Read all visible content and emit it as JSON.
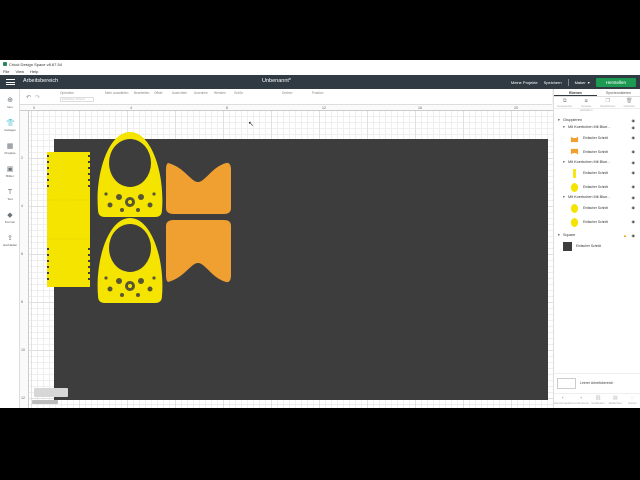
{
  "app": {
    "window_title": "Cricut Design Space  v8.67.54",
    "menu": [
      "File",
      "View",
      "Help"
    ]
  },
  "header": {
    "workspace": "Arbeitsbereich",
    "document_title": "Unbenannt*",
    "my_projects": "Meine Projekte",
    "save": "Speichern",
    "machine": "Maker",
    "make_button": "Herstellen",
    "accent_color": "#1d9a52",
    "bg_color": "#2f3a43"
  },
  "toolbar": {
    "undo_icon": "undo-icon",
    "redo_icon": "redo-icon",
    "select_all": "Alles auswählen",
    "tools": [
      {
        "label": "Operation",
        "value": "Einfacher Schnitt"
      },
      {
        "label": "Mehr auswählen",
        "value": ""
      },
      {
        "label": "Bearbeiten",
        "value": ""
      },
      {
        "label": "Offset",
        "value": ""
      },
      {
        "label": "Ausrichten",
        "value": ""
      },
      {
        "label": "Anordnen",
        "value": ""
      },
      {
        "label": "Wenden",
        "value": ""
      },
      {
        "label": "Größe",
        "value": ""
      },
      {
        "label": "Drehen",
        "value": ""
      },
      {
        "label": "Position",
        "value": ""
      }
    ]
  },
  "sidebar": {
    "items": [
      {
        "label": "Neu",
        "icon": "plus-icon"
      },
      {
        "label": "Vorlagen",
        "icon": "shirt-icon"
      },
      {
        "label": "Projekte",
        "icon": "projects-icon"
      },
      {
        "label": "Bilder",
        "icon": "image-icon"
      },
      {
        "label": "Text",
        "icon": "text-icon"
      },
      {
        "label": "Formen",
        "icon": "shapes-icon"
      },
      {
        "label": "Hochladen",
        "icon": "upload-icon"
      }
    ]
  },
  "rulers": {
    "top": [
      "0",
      "2",
      "4",
      "6",
      "8",
      "10",
      "12",
      "14",
      "16",
      "18",
      "20"
    ],
    "left": [
      "2",
      "4",
      "6",
      "8",
      "10",
      "12"
    ]
  },
  "panel": {
    "tabs": [
      "Ebenen",
      "Synchronisieren"
    ],
    "actions": [
      "Gruppieren",
      "Gruppe aufheben",
      "Duplizieren",
      "Löschen"
    ],
    "layers": [
      {
        "type": "group",
        "name": "Gruppieren",
        "level": 0
      },
      {
        "type": "group",
        "name": "Mit Koerbchen Mit Blue...",
        "level": 1
      },
      {
        "type": "item",
        "name": "Einfacher Schnitt",
        "color": "#f0a030"
      },
      {
        "type": "item",
        "name": "Einfacher Schnitt",
        "color": "#f0a030"
      },
      {
        "type": "group",
        "name": "Mit Koerbchen Mit Blue...",
        "level": 1
      },
      {
        "type": "item",
        "name": "Einfacher Schnitt",
        "color": "#f5e400"
      },
      {
        "type": "item",
        "name": "Einfacher Schnitt",
        "color": "#f5e400"
      },
      {
        "type": "group",
        "name": "Mit Koerbchen Mit Blue...",
        "level": 1
      },
      {
        "type": "item",
        "name": "Einfacher Schnitt",
        "color": "#f5e400"
      },
      {
        "type": "item",
        "name": "Einfacher Schnitt",
        "color": "#f5e400"
      },
      {
        "type": "group",
        "name": "Square",
        "level": 0,
        "warning": true
      },
      {
        "type": "item",
        "name": "Einfacher Schnitt",
        "color": "#3d3d3d"
      }
    ],
    "blank_canvas": "Leerer Arbeitsbereich",
    "bottom_actions": [
      "Zerschneiden",
      "Kombinieren",
      "Verbinden",
      "Abflachen",
      "Kontur"
    ]
  },
  "colors": {
    "mat": "#3d3d3d",
    "yellow": "#f5e400",
    "orange": "#f0a030"
  }
}
